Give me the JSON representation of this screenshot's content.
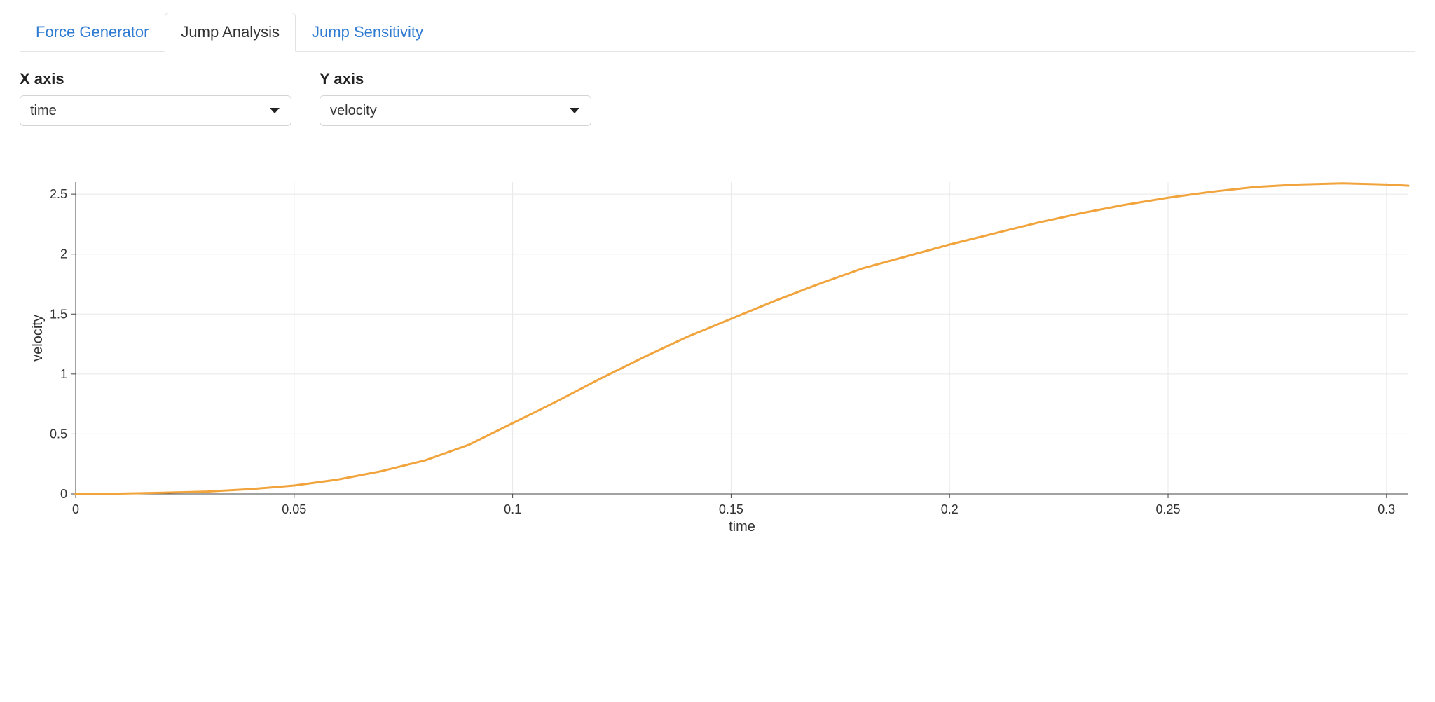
{
  "tabs": [
    {
      "label": "Force Generator",
      "active": false
    },
    {
      "label": "Jump Analysis",
      "active": true
    },
    {
      "label": "Jump Sensitivity",
      "active": false
    }
  ],
  "controls": {
    "x": {
      "label": "X axis",
      "value": "time"
    },
    "y": {
      "label": "Y axis",
      "value": "velocity"
    }
  },
  "chart_data": {
    "type": "line",
    "xlabel": "time",
    "ylabel": "velocity",
    "xlim": [
      0,
      0.305
    ],
    "ylim": [
      0,
      2.6
    ],
    "x_ticks": [
      0,
      0.05,
      0.1,
      0.15,
      0.2,
      0.25,
      0.3
    ],
    "y_ticks": [
      0,
      0.5,
      1,
      1.5,
      2,
      2.5
    ],
    "series": [
      {
        "name": "velocity",
        "color": "#f1a33c",
        "x": [
          0.0,
          0.01,
          0.02,
          0.03,
          0.04,
          0.05,
          0.06,
          0.07,
          0.08,
          0.09,
          0.1,
          0.11,
          0.12,
          0.13,
          0.14,
          0.15,
          0.16,
          0.17,
          0.18,
          0.19,
          0.2,
          0.21,
          0.22,
          0.23,
          0.24,
          0.25,
          0.26,
          0.27,
          0.28,
          0.29,
          0.3,
          0.305
        ],
        "y": [
          0.0,
          0.003,
          0.01,
          0.02,
          0.04,
          0.07,
          0.12,
          0.19,
          0.28,
          0.41,
          0.59,
          0.77,
          0.96,
          1.14,
          1.31,
          1.46,
          1.61,
          1.75,
          1.88,
          1.98,
          2.08,
          2.17,
          2.26,
          2.34,
          2.41,
          2.47,
          2.52,
          2.56,
          2.58,
          2.59,
          2.58,
          2.57
        ]
      }
    ]
  }
}
